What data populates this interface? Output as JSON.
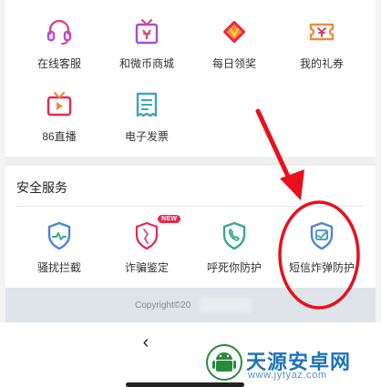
{
  "services_grid": [
    {
      "label": "在线客服",
      "icon": "headset-icon"
    },
    {
      "label": "和微币商城",
      "icon": "gift-shop-icon"
    },
    {
      "label": "每日领奖",
      "icon": "daily-reward-icon"
    },
    {
      "label": "我的礼券",
      "icon": "coupon-icon"
    },
    {
      "label": "86直播",
      "icon": "tv-live-icon"
    },
    {
      "label": "电子发票",
      "icon": "invoice-icon"
    }
  ],
  "security": {
    "title": "安全服务",
    "items": [
      {
        "label": "骚扰拦截",
        "icon": "shield-pulse-icon"
      },
      {
        "label": "诈骗鉴定",
        "icon": "shield-fraud-icon",
        "badge": "NEW"
      },
      {
        "label": "呼死你防护",
        "icon": "shield-phone-icon"
      },
      {
        "label": "短信炸弹防护",
        "icon": "shield-sms-icon"
      }
    ]
  },
  "footer": {
    "copyright": "Copyright©20"
  },
  "nav": {
    "back_glyph": "‹"
  },
  "watermark": {
    "title": "天源安卓网",
    "url": "www.jytyaz.com"
  },
  "colors": {
    "icon_magenta": "#e0457b",
    "icon_purple": "#a24fd6",
    "icon_orange": "#f08a3c",
    "icon_red": "#e8294a",
    "icon_cyan": "#3fa6b8",
    "shield_blue": "#4a86d9",
    "shield_green": "#3aa88a",
    "annotation_red": "#e8101c"
  }
}
